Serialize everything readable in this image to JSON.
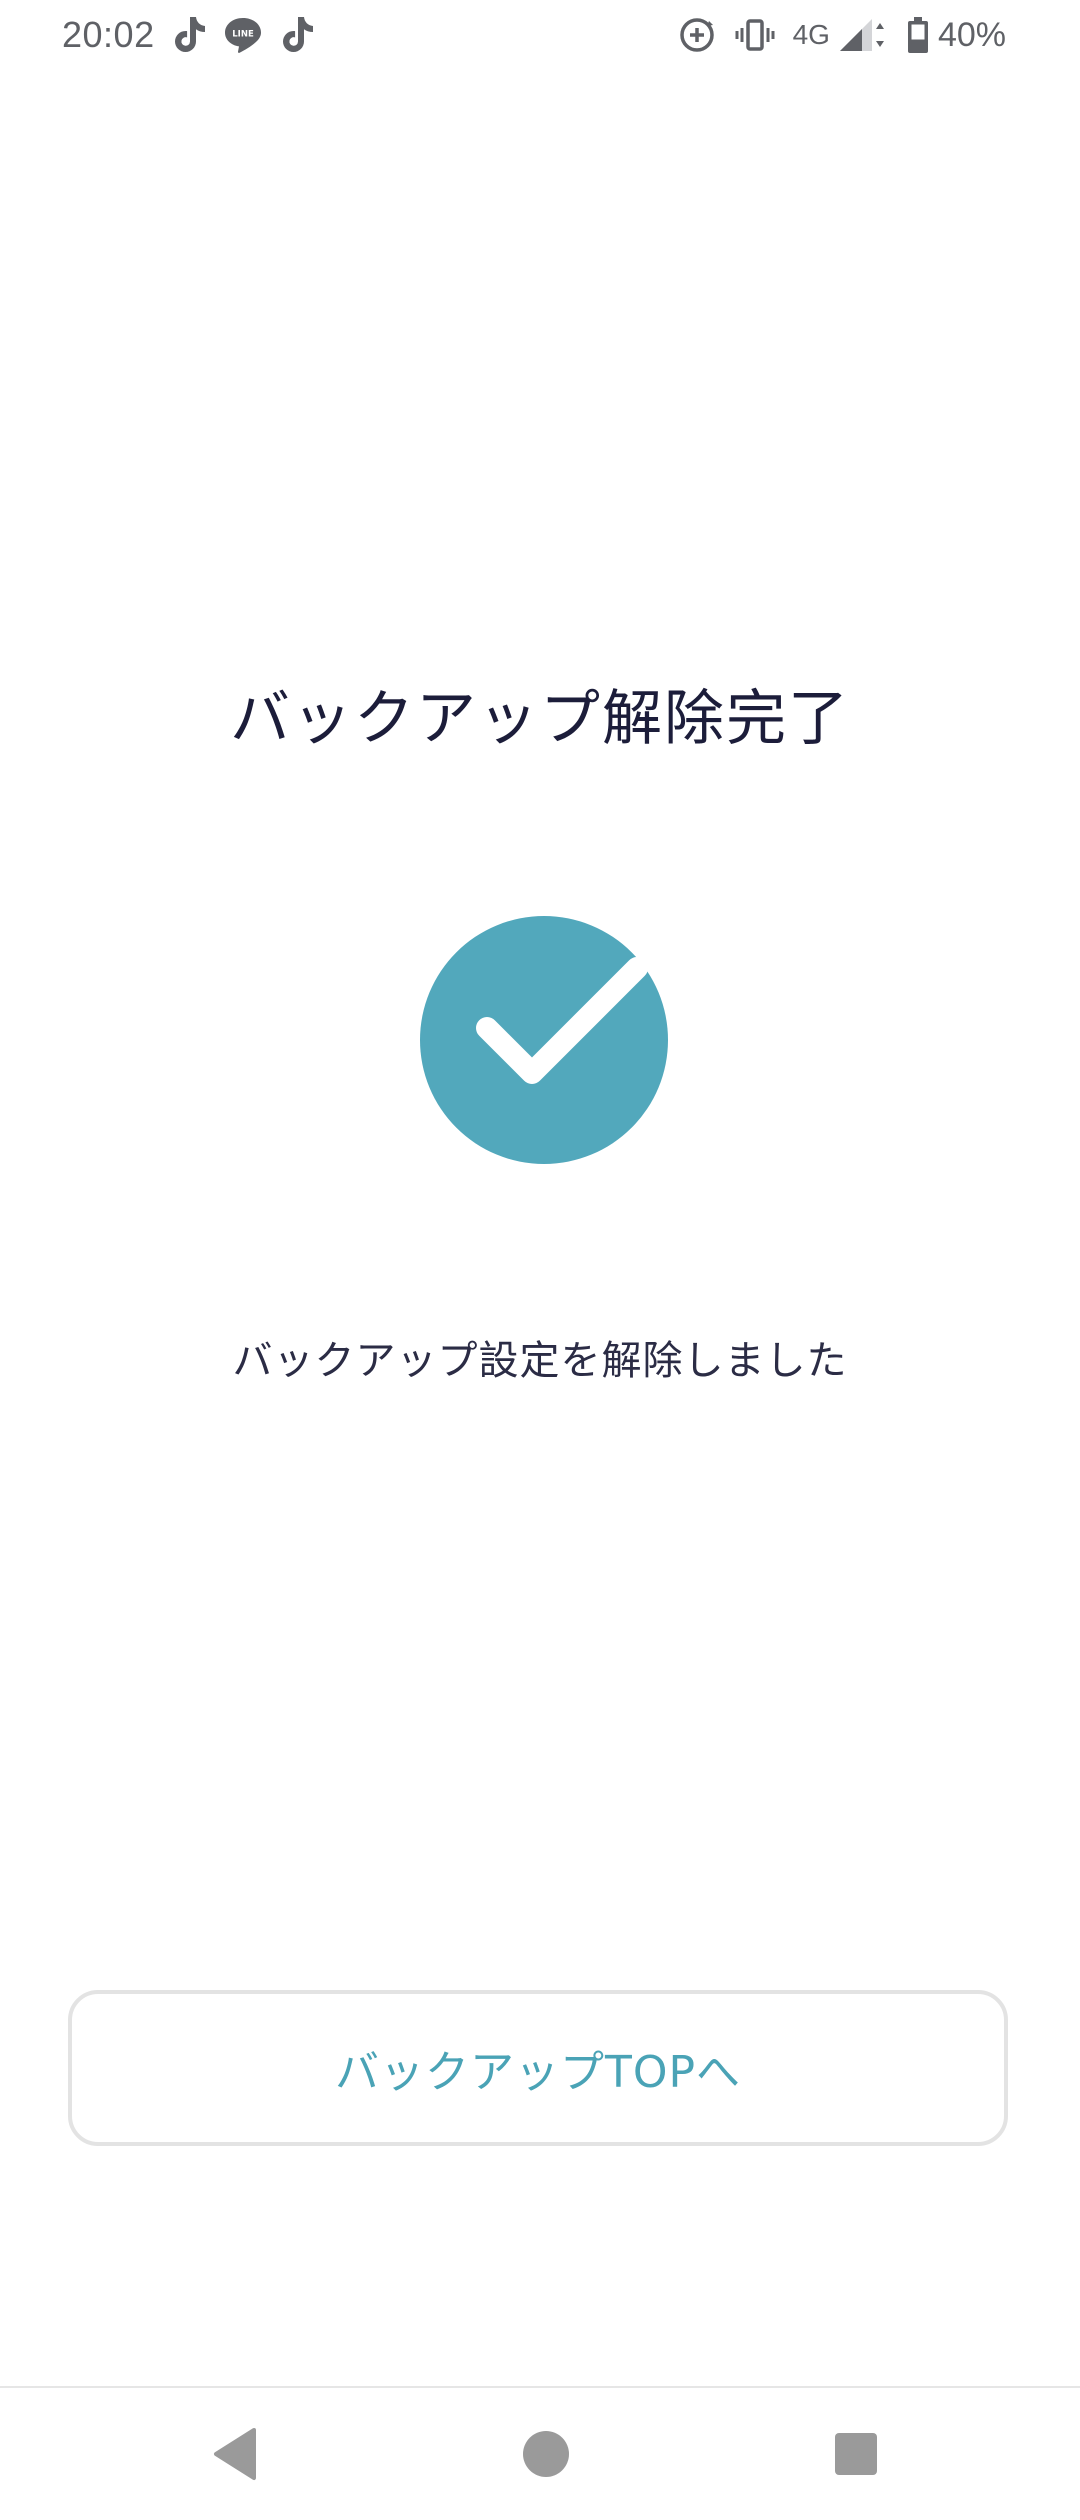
{
  "status_bar": {
    "time": "20:02",
    "network": "4G",
    "battery": "40%",
    "notification_icons": [
      "tiktok-icon",
      "line-icon",
      "tiktok-icon"
    ],
    "system_icons": [
      "screen-rotation-icon",
      "vibrate-icon",
      "signal-icon",
      "battery-icon"
    ]
  },
  "main": {
    "title": "バックアップ解除完了",
    "message": "バックアップ設定を解除しました",
    "success_icon": "check-circle-icon",
    "accent_color": "#52a8bc"
  },
  "actions": {
    "top_button_label": "バックアップTOPへ"
  },
  "navigation": {
    "items": [
      "back-icon",
      "home-icon",
      "recents-icon"
    ]
  }
}
